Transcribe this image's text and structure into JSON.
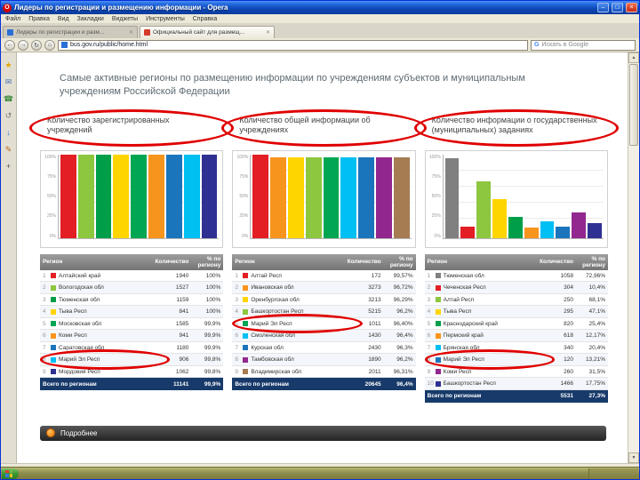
{
  "window": {
    "title": "Лидеры по регистрации и размещению информации - Opera",
    "menu": [
      "Файл",
      "Правка",
      "Вид",
      "Закладки",
      "Виджеты",
      "Инструменты",
      "Справка"
    ],
    "tabs": [
      {
        "label": "Лидеры по регистрации и разм...",
        "active": false,
        "fav_color": "#2a6fd6"
      },
      {
        "label": "Официальный сайт для размещ...",
        "active": true,
        "fav_color": "#d43a2a"
      }
    ],
    "address": "bus.gov.ru/public/home.html",
    "search_placeholder": "Искать в Google",
    "nav_icons": [
      {
        "name": "back-icon",
        "glyph": "←"
      },
      {
        "name": "forward-icon",
        "glyph": "→"
      },
      {
        "name": "reload-icon",
        "glyph": "↻"
      },
      {
        "name": "home-icon",
        "glyph": "⌂"
      }
    ],
    "panel_icons": [
      {
        "name": "bookmarks-star-icon",
        "glyph": "★",
        "color": "#e0a800"
      },
      {
        "name": "mail-icon",
        "glyph": "✉",
        "color": "#4a6fb5"
      },
      {
        "name": "contacts-phone-icon",
        "glyph": "☎",
        "color": "#3a8a3a"
      },
      {
        "name": "history-icon",
        "glyph": "↺",
        "color": "#777777"
      },
      {
        "name": "downloads-icon",
        "glyph": "↓",
        "color": "#2a6fd6"
      },
      {
        "name": "notes-icon",
        "glyph": "✎",
        "color": "#b5651d"
      },
      {
        "name": "add-panel-icon",
        "glyph": "+",
        "color": "#555555"
      }
    ],
    "controls": {
      "minimize": "–",
      "maximize": "□",
      "close": "×"
    }
  },
  "page": {
    "heading": "Самые активные регионы по размещению информации по учреждениям субъектов и муниципальным учреждениям Российской Федерации",
    "details_label": "Подробнее",
    "total_label": "Всего по регионам",
    "table_headers": {
      "region": "Регион",
      "count": "Количество",
      "pct": "% по региону"
    },
    "columns": [
      {
        "label": "Количество зарегистрированных учреждений",
        "rows": [
          {
            "n": "1",
            "color": "#e31e24",
            "region": "Алтайский край",
            "count": "1940",
            "pct": "100%"
          },
          {
            "n": "2",
            "color": "#8dc63f",
            "region": "Вологодская обл",
            "count": "1527",
            "pct": "100%"
          },
          {
            "n": "3",
            "color": "#009e49",
            "region": "Тюменская обл",
            "count": "1159",
            "pct": "100%"
          },
          {
            "n": "4",
            "color": "#ffd500",
            "region": "Тыва Респ",
            "count": "841",
            "pct": "100%"
          },
          {
            "n": "5",
            "color": "#00a651",
            "region": "Московская обл",
            "count": "1585",
            "pct": "99,9%"
          },
          {
            "n": "6",
            "color": "#f7941d",
            "region": "Коми Респ",
            "count": "941",
            "pct": "99,9%"
          },
          {
            "n": "7",
            "color": "#1b75bc",
            "region": "Саратовская обл",
            "count": "1180",
            "pct": "99,9%"
          },
          {
            "n": "8",
            "color": "#00bff3",
            "region": "Марий Эл Респ",
            "count": "906",
            "pct": "99,8%",
            "highlight": true
          },
          {
            "n": "9",
            "color": "#2e3192",
            "region": "Мордовия Респ",
            "count": "1062",
            "pct": "99,8%"
          }
        ],
        "total": {
          "count": "11141",
          "pct": "99,9%"
        }
      },
      {
        "label": "Количество общей информации об учреждениях",
        "rows": [
          {
            "n": "1",
            "color": "#e31e24",
            "region": "Алтай Респ",
            "count": "172",
            "pct": "99,57%"
          },
          {
            "n": "2",
            "color": "#f7941d",
            "region": "Ивановская обл",
            "count": "3273",
            "pct": "96,72%"
          },
          {
            "n": "3",
            "color": "#ffd500",
            "region": "Оренбургская обл",
            "count": "3213",
            "pct": "96,29%"
          },
          {
            "n": "4",
            "color": "#8dc63f",
            "region": "Башкортостан Респ",
            "count": "5215",
            "pct": "96,2%"
          },
          {
            "n": "5",
            "color": "#00a651",
            "region": "Марий Эл Респ",
            "count": "1011",
            "pct": "96,40%",
            "highlight": true
          },
          {
            "n": "6",
            "color": "#00bff3",
            "region": "Смоленская обл",
            "count": "1430",
            "pct": "96,4%"
          },
          {
            "n": "7",
            "color": "#1b75bc",
            "region": "Курская обл",
            "count": "2430",
            "pct": "96,3%"
          },
          {
            "n": "8",
            "color": "#92278f",
            "region": "Тамбовская обл",
            "count": "1890",
            "pct": "96,2%"
          },
          {
            "n": "9",
            "color": "#a67c52",
            "region": "Владимирская обл",
            "count": "2011",
            "pct": "96,31%"
          }
        ],
        "total": {
          "count": "20645",
          "pct": "96,4%"
        }
      },
      {
        "label": "Количество информации о государственных (муниципальных) заданиях",
        "rows": [
          {
            "n": "1",
            "color": "#808080",
            "region": "Тюменская обл",
            "count": "1058",
            "pct": "72,96%"
          },
          {
            "n": "2",
            "color": "#e31e24",
            "region": "Чеченская Респ",
            "count": "304",
            "pct": "10,4%"
          },
          {
            "n": "3",
            "color": "#8dc63f",
            "region": "Алтай Респ",
            "count": "250",
            "pct": "68,1%"
          },
          {
            "n": "4",
            "color": "#ffd500",
            "region": "Тыва Респ",
            "count": "295",
            "pct": "47,1%"
          },
          {
            "n": "5",
            "color": "#009e49",
            "region": "Краснодарский край",
            "count": "820",
            "pct": "25,4%"
          },
          {
            "n": "6",
            "color": "#f7941d",
            "region": "Пермский край",
            "count": "618",
            "pct": "12,17%"
          },
          {
            "n": "7",
            "color": "#00bff3",
            "region": "Брянская обл",
            "count": "340",
            "pct": "20,4%"
          },
          {
            "n": "8",
            "color": "#1b75bc",
            "region": "Марий Эл Респ",
            "count": "120",
            "pct": "13,21%",
            "highlight": true
          },
          {
            "n": "9",
            "color": "#92278f",
            "region": "Коми Респ",
            "count": "260",
            "pct": "31,5%"
          },
          {
            "n": "10",
            "color": "#2e3192",
            "region": "Башкортостан Респ",
            "count": "1466",
            "pct": "17,75%"
          }
        ],
        "total": {
          "count": "5531",
          "pct": "27,3%"
        }
      }
    ]
  },
  "chart_data": [
    {
      "type": "bar",
      "title": "Количество зарегистрированных учреждений, % по региону",
      "ylim": [
        0,
        100
      ],
      "ticks": [
        "100%",
        "75%",
        "50%",
        "25%",
        "0%"
      ],
      "values": [
        100,
        100,
        100,
        100,
        99.9,
        99.9,
        99.9,
        99.8,
        99.8
      ],
      "colors": [
        "#e31e24",
        "#8dc63f",
        "#009e49",
        "#ffd500",
        "#00a651",
        "#f7941d",
        "#1b75bc",
        "#00bff3",
        "#2e3192"
      ]
    },
    {
      "type": "bar",
      "title": "Количество общей информации об учреждениях, % по региону",
      "ylim": [
        0,
        100
      ],
      "ticks": [
        "100%",
        "75%",
        "50%",
        "25%",
        "0%"
      ],
      "values": [
        99.6,
        96.7,
        96.3,
        96.2,
        96.4,
        96.4,
        96.3,
        96.2,
        96.3
      ],
      "colors": [
        "#e31e24",
        "#f7941d",
        "#ffd500",
        "#8dc63f",
        "#00a651",
        "#00bff3",
        "#1b75bc",
        "#92278f",
        "#a67c52"
      ]
    },
    {
      "type": "bar",
      "title": "Количество информации о государственных (муниципальных) заданиях, % по региону",
      "ylim": [
        0,
        100
      ],
      "ticks": [
        "100%",
        "75%",
        "50%",
        "25%",
        "0%"
      ],
      "values": [
        95,
        14,
        68,
        47,
        25,
        12,
        20,
        13,
        31,
        18
      ],
      "colors": [
        "#808080",
        "#e31e24",
        "#8dc63f",
        "#ffd500",
        "#009e49",
        "#f7941d",
        "#00bff3",
        "#1b75bc",
        "#92278f",
        "#2e3192"
      ]
    }
  ]
}
